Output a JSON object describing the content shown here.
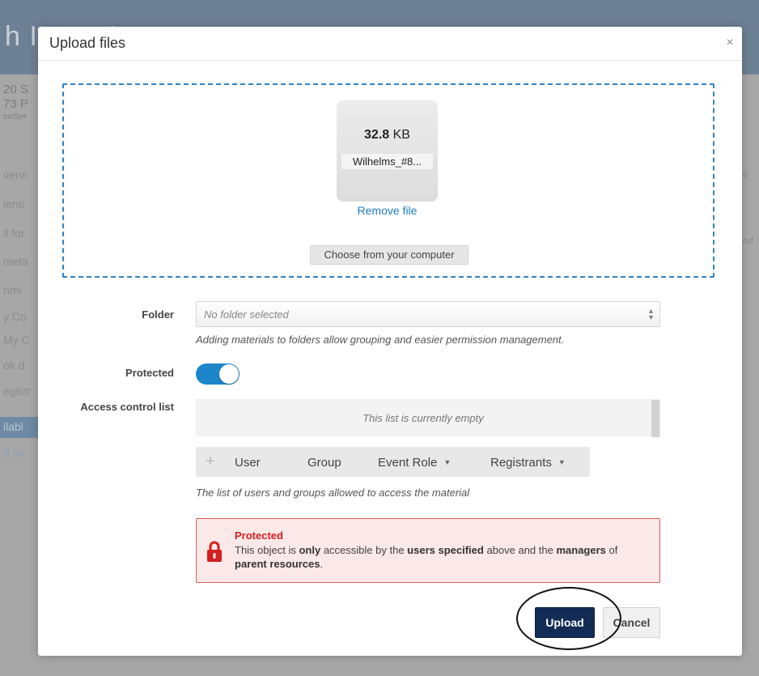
{
  "background": {
    "header_title": "h Ins… Assoc…",
    "info_lines": [
      "20 S",
      "73 P",
      "ce/Ser"
    ],
    "sidebar_items": [
      "vervi",
      "ienti",
      "ll for",
      "meta",
      "nmi",
      "y Co",
      "My C",
      "ok d",
      "egistr",
      "ilabl",
      "d su"
    ],
    "right_texts": [
      "e",
      "ruf"
    ]
  },
  "modal": {
    "title": "Upload files",
    "close_icon": "×"
  },
  "dropzone": {
    "file_size_value": "32.8",
    "file_size_unit": "KB",
    "file_name": "Wilhelms_#8...",
    "remove_label": "Remove file",
    "choose_label": "Choose from your computer"
  },
  "form": {
    "folder_label": "Folder",
    "folder_value": "No folder selected",
    "folder_help": "Adding materials to folders allow grouping and easier permission management.",
    "protected_label": "Protected",
    "protected_on": true,
    "acl_label": "Access control list",
    "acl_empty": "This list is currently empty",
    "acl_plus": "+",
    "acl_items": [
      "User",
      "Group",
      "Event Role",
      "Registrants"
    ],
    "acl_help": "The list of users and groups allowed to access the material"
  },
  "alert": {
    "title": "Protected",
    "text_1": "This object is ",
    "text_2": "only",
    "text_3": " accessible by the ",
    "text_4": "users specified",
    "text_5": " above and the ",
    "text_6": "managers",
    "text_7": " of ",
    "text_8": "parent resources",
    "text_9": "."
  },
  "actions": {
    "upload_label": "Upload",
    "cancel_label": "Cancel"
  },
  "colors": {
    "accent": "#1d86c9",
    "primary_button": "#132c55",
    "alert_red": "#d31f1f",
    "alert_bg": "#fbe8e8"
  }
}
